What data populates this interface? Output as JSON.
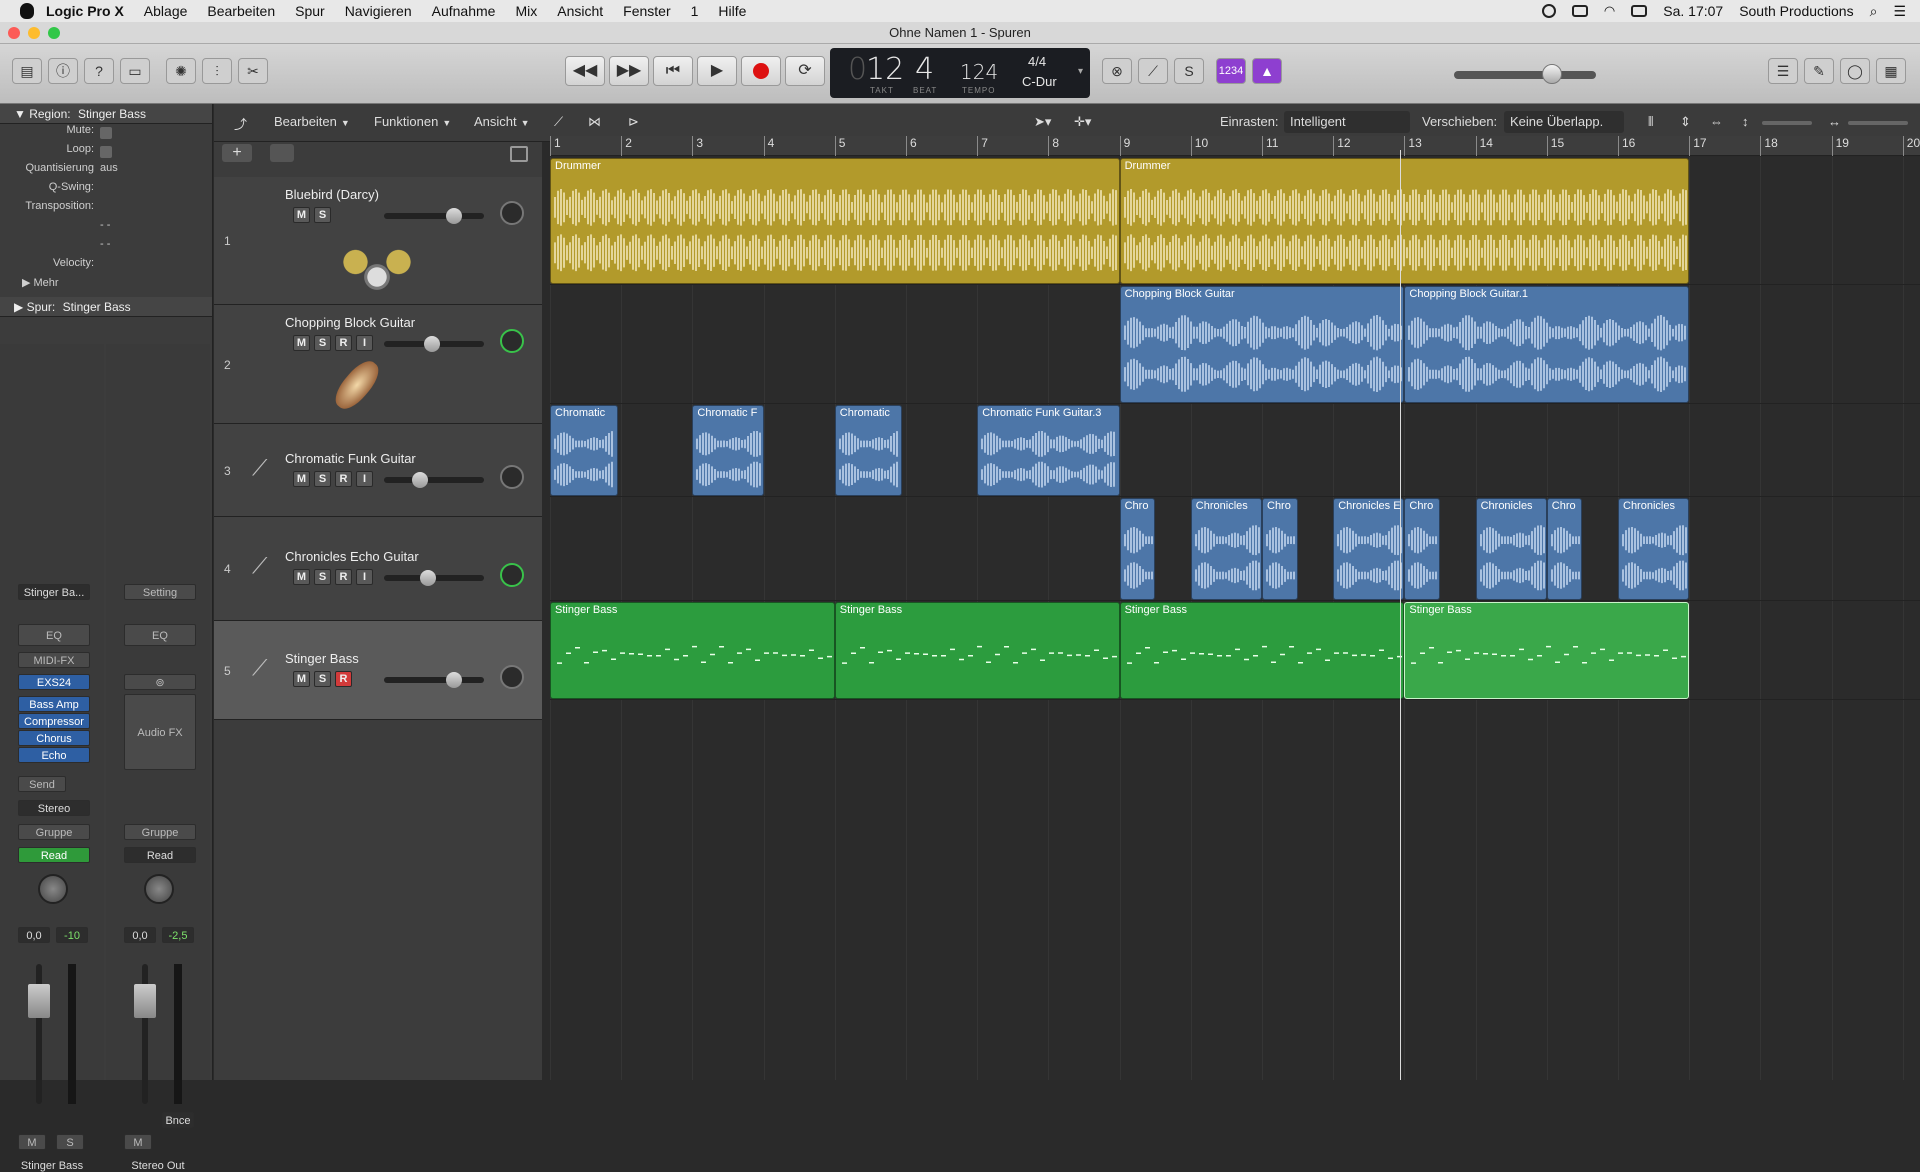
{
  "menubar": {
    "app": "Logic Pro X",
    "items": [
      "Ablage",
      "Bearbeiten",
      "Spur",
      "Navigieren",
      "Aufnahme",
      "Mix",
      "Ansicht",
      "Fenster",
      "1",
      "Hilfe"
    ],
    "clock": "Sa. 17:07",
    "user": "South Productions"
  },
  "window": {
    "title": "Ohne Namen 1 - Spuren"
  },
  "lcd": {
    "takt": "12",
    "beat": "4",
    "takt_label": "TAKT",
    "beat_label": "BEAT",
    "tempo": "124",
    "tempo_label": "TEMPO",
    "signature": "4/4",
    "key": "C-Dur"
  },
  "controlbar": {
    "count_in": "1234"
  },
  "inspector": {
    "region_label": "Region:",
    "region_name": "Stinger Bass",
    "rows": [
      {
        "key": "Mute:",
        "value": ""
      },
      {
        "key": "Loop:",
        "value": ""
      },
      {
        "key": "Quantisierung",
        "value": "aus"
      },
      {
        "key": "Q-Swing:",
        "value": ""
      },
      {
        "key": "Transposition:",
        "value": ""
      },
      {
        "key": "",
        "value": "- -"
      },
      {
        "key": "",
        "value": "- -"
      },
      {
        "key": "Velocity:",
        "value": ""
      }
    ],
    "more": "Mehr",
    "track_label": "Spur:",
    "track_name": "Stinger Bass",
    "strip1": {
      "setting": "Stinger Ba...",
      "eq": "EQ",
      "midifx": "MIDI-FX",
      "instrument": "EXS24",
      "fx": [
        "Bass Amp",
        "Compressor",
        "Chorus",
        "Echo"
      ],
      "send": "Send",
      "output": "Stereo",
      "group": "Gruppe",
      "automation": "Read",
      "vol": "0,0",
      "peak": "-10",
      "mute": "M",
      "solo": "S",
      "name": "Stinger Bass"
    },
    "strip2": {
      "setting": "Setting",
      "eq": "EQ",
      "audiofx": "Audio FX",
      "group": "Gruppe",
      "automation": "Read",
      "vol": "0,0",
      "peak": "-2,5",
      "bounce": "Bnce",
      "mute": "M",
      "name": "Stereo Out"
    }
  },
  "toolbar": {
    "edit": "Bearbeiten",
    "functions": "Funktionen",
    "view": "Ansicht",
    "snap_label": "Einrasten:",
    "snap_value": "Intelligent",
    "drag_label": "Verschieben:",
    "drag_value": "Keine Überlapp."
  },
  "ruler": {
    "bars": [
      "1",
      "2",
      "3",
      "4",
      "5",
      "6",
      "7",
      "8",
      "9",
      "10",
      "11",
      "12",
      "13",
      "14",
      "15",
      "16",
      "17",
      "18",
      "19",
      "20"
    ]
  },
  "tracks": [
    {
      "num": "1",
      "name": "Bluebird (Darcy)",
      "buttons": [
        "M",
        "S"
      ]
    },
    {
      "num": "2",
      "name": "Chopping Block Guitar",
      "buttons": [
        "M",
        "S",
        "R",
        "I"
      ]
    },
    {
      "num": "3",
      "name": "Chromatic Funk Guitar",
      "buttons": [
        "M",
        "S",
        "R",
        "I"
      ]
    },
    {
      "num": "4",
      "name": "Chronicles Echo Guitar",
      "buttons": [
        "M",
        "S",
        "R",
        "I"
      ]
    },
    {
      "num": "5",
      "name": "Stinger Bass",
      "buttons": [
        "M",
        "S",
        "R"
      ]
    }
  ],
  "regions": {
    "drummer": [
      "Drummer",
      "Drummer"
    ],
    "chopping": [
      "Chopping Block Guitar",
      "Chopping Block Guitar.1"
    ],
    "chromatic": [
      "Chromatic",
      "Chromatic F",
      "Chromatic",
      "Chromatic Funk Guitar.3"
    ],
    "chronicles": [
      "Chro",
      "Chronicles",
      "Chro",
      "Chronicles E",
      "Chro",
      "Chronicles",
      "Chro",
      "Chronicles"
    ],
    "bass": [
      "Stinger Bass",
      "Stinger Bass",
      "Stinger Bass",
      "Stinger Bass"
    ]
  },
  "colors": {
    "drummer": "#b29a2b",
    "audio": "#4d76a8",
    "midi": "#2c9c3e",
    "record": "#d23a3a",
    "accent": "#8e3fd0"
  }
}
